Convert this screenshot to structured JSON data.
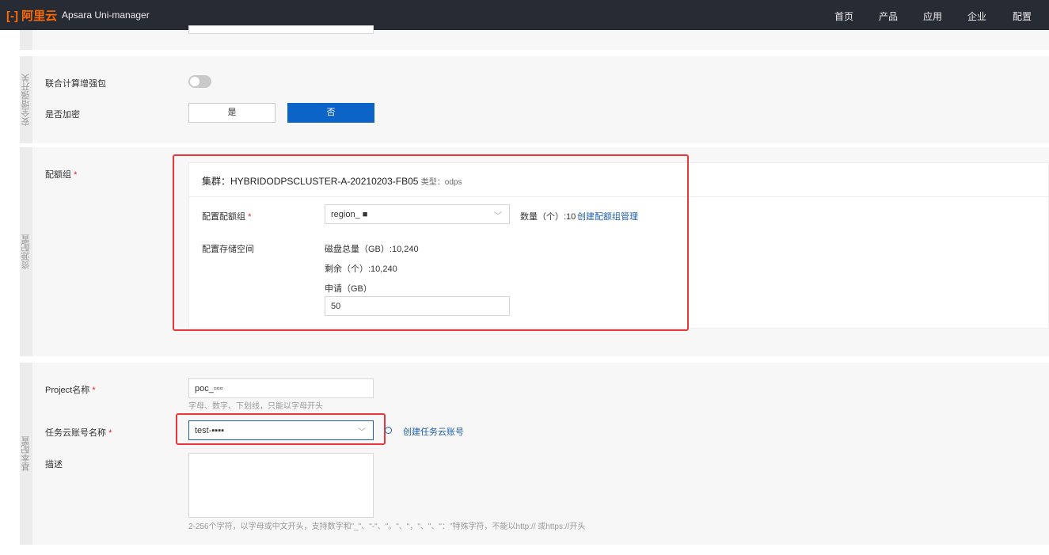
{
  "header": {
    "logo": "阿里云",
    "product": "Apsara Uni-manager",
    "nav": [
      "首页",
      "产品",
      "应用",
      "企业",
      "配置"
    ]
  },
  "security": {
    "section_label": "安全增强开关",
    "federated_label": "联合计算增强包",
    "federated_on": false,
    "encrypt_label": "是否加密",
    "yes": "是",
    "no": "否",
    "selected": "否"
  },
  "resource": {
    "section_label": "资源配置",
    "quota_label": "配额组",
    "cluster_prefix": "集群：",
    "cluster_name": "HYBRIDODPSCLUSTER-A-20210203-FB05",
    "type_text": "类型：odps",
    "quota_group_label": "配置配额组",
    "quota_group_value": "region_ ■",
    "count_text": "数量（个）:10",
    "create_quota_link": "创建配额组管理",
    "storage_label": "配置存储空间",
    "disk_total": "磁盘总量（GB）:10,240",
    "remaining": "剩余（个）:10,240",
    "apply_label": "申请（GB）",
    "apply_value": "50"
  },
  "basic": {
    "section_label": "基本配置",
    "project_label": "Project名称",
    "project_value": "poc_▫▫▫",
    "project_hint": "字母、数字、下划线，只能以字母开头",
    "account_label": "任务云账号名称",
    "account_value": "test-▪▪▪▪",
    "create_account_link": "创建任务云账号",
    "desc_label": "描述",
    "desc_value": "",
    "desc_hint": "2-256个字符，以字母或中文开头，支持数字和\"_\"、\"-\"、\"。\"、\"，\"、\"、\"：\"特殊字符，不能以http:// 或https://开头"
  },
  "required_mark": "*"
}
